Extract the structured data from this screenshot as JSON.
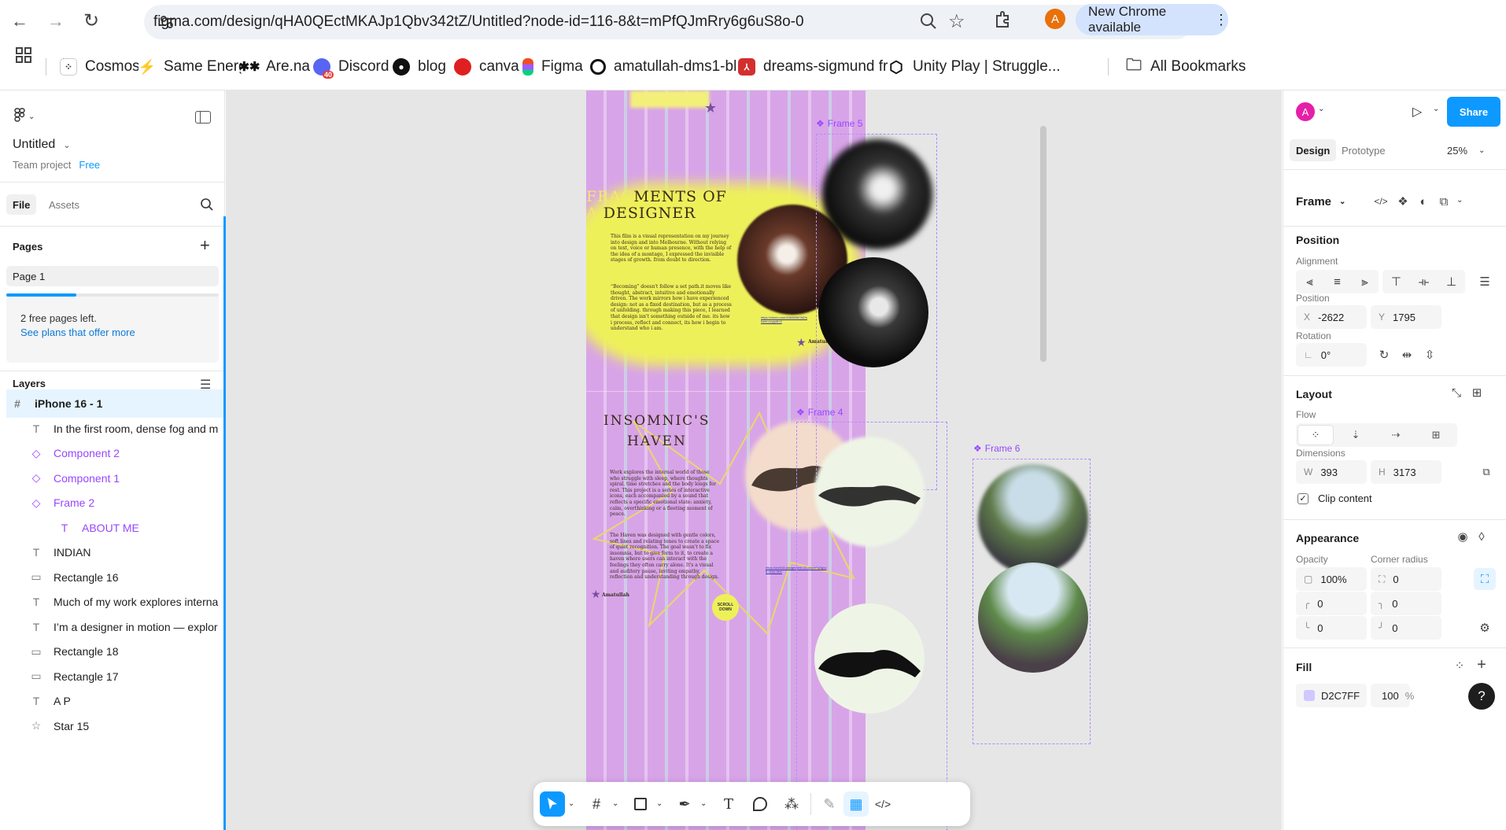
{
  "browser": {
    "url": "figma.com/design/qHA0QEctMKAJp1Qbv342tZ/Untitled?node-id=116-8&t=mPfQJmRry6g6uS8o-0",
    "profile_initial": "A",
    "update_label": "New Chrome available",
    "bookmarks": [
      {
        "label": "Cosmos"
      },
      {
        "label": "Same Energy"
      },
      {
        "label": "Are.na"
      },
      {
        "label": "Discord",
        "badge": "40"
      },
      {
        "label": "blog"
      },
      {
        "label": "canva"
      },
      {
        "label": "Figma"
      },
      {
        "label": "amatullah-dms1-bl..."
      },
      {
        "label": "dreams-sigmund fr..."
      },
      {
        "label": "Unity Play | Struggle..."
      }
    ],
    "all_bookmarks": "All Bookmarks"
  },
  "left": {
    "file_name": "Untitled",
    "project": "Team project",
    "plan": "Free",
    "tab_file": "File",
    "tab_assets": "Assets",
    "pages_title": "Pages",
    "page1": "Page 1",
    "free_pages": "2 free pages left.",
    "see_plans": "See plans that offer more",
    "layers_title": "Layers",
    "layers": [
      {
        "label": "iPhone 16 - 1",
        "icon": "frame-icon"
      },
      {
        "label": "In the first room, dense fog and m",
        "icon": "text-icon"
      },
      {
        "label": "Component 2",
        "icon": "component-icon"
      },
      {
        "label": "Component 1",
        "icon": "component-icon"
      },
      {
        "label": "Frame 2",
        "icon": "component-icon"
      },
      {
        "label": "ABOUT ME",
        "icon": "text-icon"
      },
      {
        "label": "INDIAN",
        "icon": "text-icon"
      },
      {
        "label": "Rectangle 16",
        "icon": "rectangle-icon"
      },
      {
        "label": "Much of my work explores interna",
        "icon": "text-icon"
      },
      {
        "label": "I’m a designer in motion — explor",
        "icon": "text-icon"
      },
      {
        "label": "Rectangle 18",
        "icon": "rectangle-icon"
      },
      {
        "label": "Rectangle 17",
        "icon": "rectangle-icon"
      },
      {
        "label": "A P",
        "icon": "text-icon"
      },
      {
        "label": "Star 15",
        "icon": "star-icon"
      }
    ]
  },
  "canvas": {
    "frame5_label": "Frame 5",
    "frame4_label": "Frame 4",
    "frame6_label": "Frame 6",
    "poster": {
      "title1a": "FRAG",
      "title1b": "MENTS OF",
      "title2a": "A ",
      "title2b": "DESIGNER",
      "para1": "This film is a visual representation on my journey into design and into Melbourne. Without relying on text, voice or human presence, with the help of the idea of a montage, I expressed the invisible stages of growth. from doubt to direction.",
      "para2": "“Becoming” doesn't follow a set path.it moves like thought, abstract, intuitive and emotionally driven. The work mirrors how i have experienced design: not as a fixed destination, but as a process of unfolding. through making this piece, I learned that design isn't something outside of me. its how i process, reflect and connect, its how i begin to understand who i am.",
      "link1": "https://vimeo.com/1069896738?share=copy#t=0",
      "signature": "Amatullah",
      "title3": "INSOMNIC'S",
      "title4": "HAVEN",
      "para3": "Work explores the internal world of those who struggle with sleep, where thoughts spiral, time stretches and the body longs for rest. This project is a series of interactive icons, each accompanied by a sound that reflects a specific emotional state: anxiety, calm, overthinking or a fleeting moment of peace.",
      "para4": "The Haven was designed with gentle colors, soft lines and relating tones to create a space of quiet recognition. The goal wasn't to fix insomnia, but to give form to it, to create a haven where users can interact with the feelings they often carry alone. It's a visual and auditory pause, inviting empathy, reflection and understanding through design.",
      "link2": "https://wiv018-assignment-22-canvb7g3g1o8.deno.dev/",
      "signature2": "Amatullah",
      "scroll": "SCROLL DOWN"
    }
  },
  "right": {
    "avatar": "A",
    "share": "Share",
    "tab_design": "Design",
    "tab_prototype": "Prototype",
    "zoom": "25%",
    "selection": "Frame",
    "position_title": "Position",
    "alignment_label": "Alignment",
    "position_label": "Position",
    "x_label": "X",
    "x_value": "-2622",
    "y_label": "Y",
    "y_value": "1795",
    "rotation_label": "Rotation",
    "rotation_value": "0°",
    "layout_title": "Layout",
    "flow_label": "Flow",
    "dimensions_label": "Dimensions",
    "w_label": "W",
    "w_value": "393",
    "h_label": "H",
    "h_value": "3173",
    "clip_content": "Clip content",
    "appearance_title": "Appearance",
    "opacity_label": "Opacity",
    "opacity_value": "100%",
    "corner_label": "Corner radius",
    "corner_value": "0",
    "corner_tl": "0",
    "corner_tr": "0",
    "corner_bl": "0",
    "corner_br": "0",
    "fill_title": "Fill",
    "fill_hex": "D2C7FF",
    "fill_color": "#D2C7FF",
    "fill_opacity": "100",
    "fill_pct": "%",
    "help": "?"
  }
}
